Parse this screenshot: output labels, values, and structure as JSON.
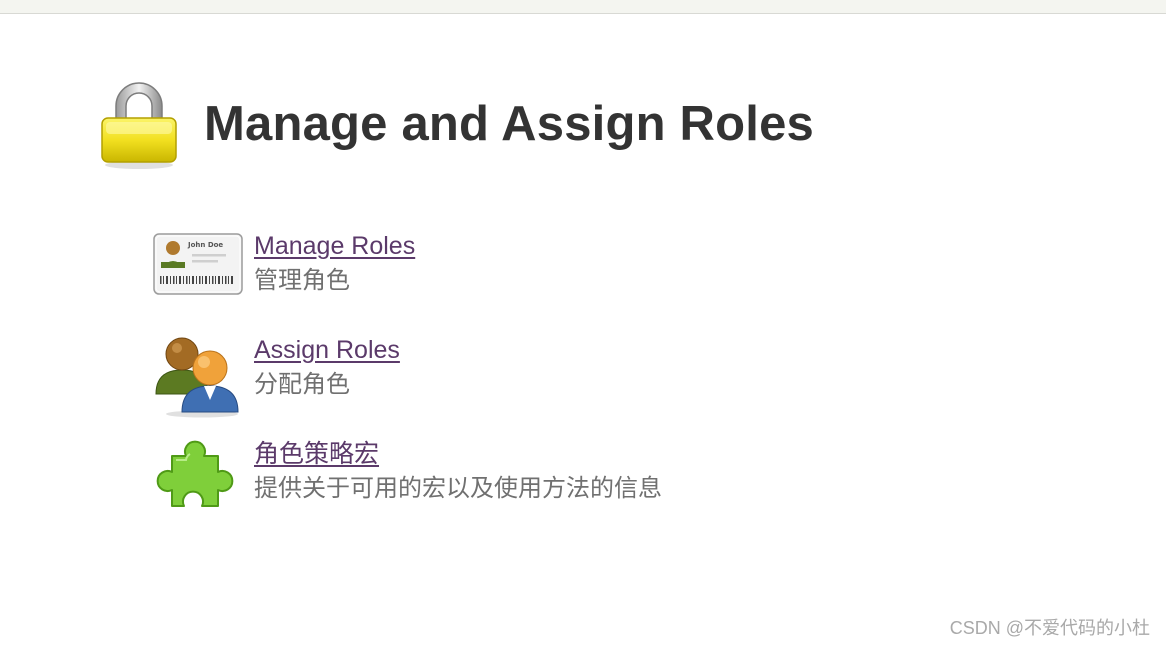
{
  "header": {
    "title": "Manage and Assign Roles",
    "icon": "lock-icon"
  },
  "menu": {
    "items": [
      {
        "label": "Manage Roles",
        "description": "管理角色",
        "icon": "id-card-icon"
      },
      {
        "label": "Assign Roles",
        "description": "分配角色",
        "icon": "users-icon"
      },
      {
        "label": "角色策略宏",
        "description": "提供关于可用的宏以及使用方法的信息",
        "icon": "puzzle-piece-icon"
      }
    ]
  },
  "watermark": "CSDN @不爱代码的小杜",
  "colors": {
    "link": "#5b3a6a",
    "description": "#707070",
    "title": "#333333",
    "lock_body": "#f2e020",
    "puzzle": "#7fcf3a"
  }
}
